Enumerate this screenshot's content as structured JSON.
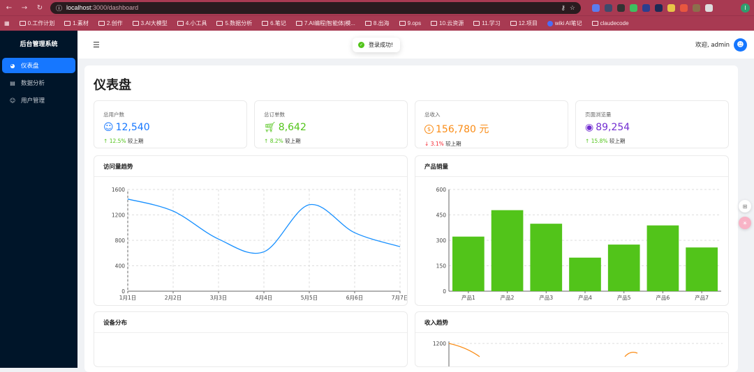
{
  "browser": {
    "url_host": "localhost",
    "url_path": ":3000/dashboard",
    "bookmarks": [
      "0.工作计划",
      "1.素材",
      "2.创作",
      "3.AI大模型",
      "4.小工具",
      "5.数据分析",
      "6.笔记",
      "7.AI编程|智能体|模...",
      "8.出海",
      "9.ops",
      "10.云资源",
      "11.学习",
      "12.项目",
      "wiki AI笔记",
      "claudecode"
    ]
  },
  "sidebar": {
    "title": "后台管理系统",
    "items": [
      {
        "label": "仪表盘",
        "icon": "dashboard-icon",
        "active": true
      },
      {
        "label": "数据分析",
        "icon": "chart-icon",
        "active": false
      },
      {
        "label": "用户管理",
        "icon": "user-icon",
        "active": false
      }
    ]
  },
  "header": {
    "welcome": "欢迎, admin",
    "toast": "登录成功!"
  },
  "page": {
    "title": "仪表盘"
  },
  "stats": [
    {
      "label": "总用户数",
      "value": "12,540",
      "icon": "user-icon",
      "color": "#1677ff",
      "change": "12.5%",
      "direction": "up",
      "compare": "较上期"
    },
    {
      "label": "总订单数",
      "value": "8,642",
      "icon": "cart-icon",
      "color": "#52c41a",
      "change": "8.2%",
      "direction": "up",
      "compare": "较上期"
    },
    {
      "label": "总收入",
      "value": "156,780 元",
      "icon": "dollar-icon",
      "color": "#fa8c16",
      "change": "3.1%",
      "direction": "down",
      "compare": "较上期"
    },
    {
      "label": "页面浏览量",
      "value": "89,254",
      "icon": "eye-icon",
      "color": "#722ed1",
      "change": "15.8%",
      "direction": "up",
      "compare": "较上期"
    }
  ],
  "charts": {
    "visits_title": "访问量趋势",
    "sales_title": "产品销量",
    "device_title": "设备分布",
    "income_title": "收入趋势"
  },
  "chart_data": [
    {
      "type": "line",
      "title": "访问量趋势",
      "categories": [
        "1月1日",
        "2月2日",
        "3月3日",
        "4月4日",
        "5月5日",
        "6月6日",
        "7月7日"
      ],
      "values": [
        1450,
        1260,
        820,
        620,
        1360,
        920,
        700
      ],
      "ylim": [
        0,
        1600
      ],
      "yticks": [
        0,
        400,
        800,
        1200,
        1600
      ],
      "color": "#1890ff",
      "grid": true
    },
    {
      "type": "bar",
      "title": "产品销量",
      "categories": [
        "产品1",
        "产品2",
        "产品3",
        "产品4",
        "产品5",
        "产品6",
        "产品7"
      ],
      "values": [
        322,
        478,
        398,
        198,
        275,
        388,
        258
      ],
      "ylim": [
        0,
        600
      ],
      "yticks": [
        0,
        150,
        300,
        450,
        600
      ],
      "color": "#52c41a",
      "grid": true
    },
    {
      "type": "line",
      "title": "收入趋势",
      "yticks": [
        1200
      ],
      "color": "#fa8c16"
    }
  ]
}
